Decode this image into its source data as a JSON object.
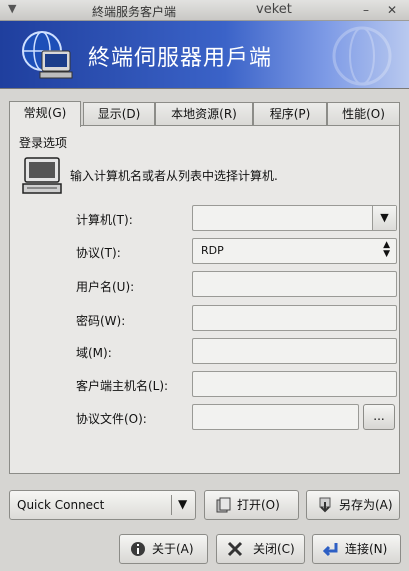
{
  "window": {
    "title": "終端服务客户端",
    "app_name": "veket",
    "menu_glyph": "▼",
    "minimize_glyph": "–",
    "close_glyph": "✕"
  },
  "banner": {
    "title": "終端伺服器用戶端"
  },
  "tabs": [
    {
      "label": "常规(G)",
      "active": true
    },
    {
      "label": "显示(D)",
      "active": false
    },
    {
      "label": "本地资源(R)",
      "active": false
    },
    {
      "label": "程序(P)",
      "active": false
    },
    {
      "label": "性能(O)",
      "active": false
    }
  ],
  "general": {
    "section_label": "登录选项",
    "hint": "输入计算机名或者从列表中选择计算机.",
    "fields": {
      "computer": {
        "label": "计算机(T):",
        "value": ""
      },
      "protocol": {
        "label": "协议(T):",
        "value": "RDP"
      },
      "username": {
        "label": "用户名(U):",
        "value": ""
      },
      "password": {
        "label": "密码(W):",
        "value": ""
      },
      "domain": {
        "label": "域(M):",
        "value": ""
      },
      "client_hostname": {
        "label": "客户端主机名(L):",
        "value": ""
      },
      "protocol_file": {
        "label": "协议文件(O):",
        "value": "",
        "browse_label": "..."
      }
    }
  },
  "bottom": {
    "quick_connect": "Quick Connect",
    "open": "打开(O)",
    "save_as": "另存为(A)",
    "about": "关于(A)",
    "close": "关闭(C)",
    "connect": "连接(N)"
  }
}
